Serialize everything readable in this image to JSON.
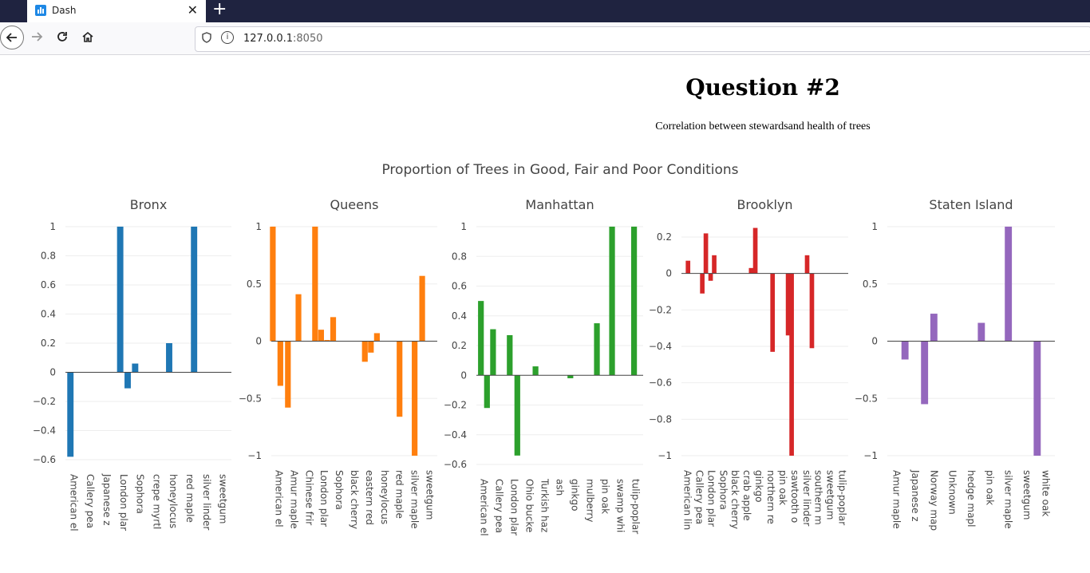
{
  "browser": {
    "tab_title": "Dash",
    "tab_close": "✕",
    "new_tab": "+",
    "url_host": "127.0.0.1",
    "url_port": ":8050"
  },
  "page": {
    "title": "Question #2",
    "subtitle": "Correlation between stewardsand health of trees"
  },
  "chart_data": {
    "type": "bar",
    "title": "Proportion of Trees in Good, Fair and Poor Conditions",
    "grid": true,
    "subplots": [
      {
        "name": "Bronx",
        "color": "#1f77b4",
        "ylim": [
          -0.6,
          1
        ],
        "yticks": [
          1,
          0.8,
          0.6,
          0.4,
          0.2,
          0,
          -0.2,
          -0.4,
          -0.6
        ],
        "ytick_labels": [
          "1",
          "0.8",
          "0.6",
          "0.4",
          "0.2",
          "0",
          "−0.2",
          "−0.4",
          "−0.6"
        ],
        "categories": [
          "American el",
          "Callery pea",
          "Japanese z",
          "London plar",
          "Sophora",
          "crepe myrtl",
          "honeylocus",
          "red maple",
          "silver linder",
          "sweetgum"
        ],
        "x": [
          0.5,
          1.5,
          2.5,
          3.5,
          4.5,
          5.5,
          6.5,
          7.5,
          8.5,
          9.5
        ],
        "bars": [
          {
            "x": 0.3,
            "y": -0.58
          },
          {
            "x": 3.3,
            "y": 1.0
          },
          {
            "x": 3.75,
            "y": -0.11
          },
          {
            "x": 4.2,
            "y": 0.06
          },
          {
            "x": 6.25,
            "y": 0.2
          },
          {
            "x": 7.75,
            "y": 1.0
          }
        ]
      },
      {
        "name": "Queens",
        "color": "#ff7f0e",
        "ylim": [
          -1,
          1
        ],
        "yticks": [
          1,
          0.5,
          0,
          -0.5,
          -1
        ],
        "ytick_labels": [
          "1",
          "0.5",
          "0",
          "−0.5",
          "−1"
        ],
        "categories": [
          "American el",
          "Amur maple",
          "Chinese frir",
          "London plar",
          "Sophora",
          "black cherry",
          "eastern red",
          "honeylocus",
          "red maple",
          "silver maple",
          "sweetgum"
        ],
        "x": [
          0.5,
          1.5,
          2.5,
          3.5,
          4.5,
          5.5,
          6.5,
          7.5,
          8.5,
          9.5,
          10.5
        ],
        "bars": [
          {
            "x": 0.1,
            "y": 1.0
          },
          {
            "x": 0.6,
            "y": -0.39
          },
          {
            "x": 1.1,
            "y": -0.58
          },
          {
            "x": 1.8,
            "y": 0.41
          },
          {
            "x": 2.9,
            "y": 1.0
          },
          {
            "x": 3.3,
            "y": 0.1
          },
          {
            "x": 3.7,
            "y": 0.01
          },
          {
            "x": 4.1,
            "y": 0.21
          },
          {
            "x": 6.2,
            "y": -0.18
          },
          {
            "x": 6.6,
            "y": -0.1
          },
          {
            "x": 7.0,
            "y": 0.07
          },
          {
            "x": 8.5,
            "y": -0.66
          },
          {
            "x": 9.5,
            "y": -1.0
          },
          {
            "x": 10.0,
            "y": 0.57
          }
        ]
      },
      {
        "name": "Manhattan",
        "color": "#2ca02c",
        "ylim": [
          -0.6,
          1
        ],
        "yticks": [
          1,
          0.8,
          0.6,
          0.4,
          0.2,
          0,
          -0.2,
          -0.4,
          -0.6
        ],
        "ytick_labels": [
          "1",
          "0.8",
          "0.6",
          "0.4",
          "0.2",
          "0",
          "−0.2",
          "−0.4",
          "−0.6"
        ],
        "categories": [
          "American el",
          "Callery pea",
          "London plar",
          "Ohio bucke",
          "Turkish haz",
          "ash",
          "ginkgo",
          "mulberry",
          "pin oak",
          "swamp whi",
          "tulip-poplar"
        ],
        "x": [
          0.5,
          1.5,
          2.5,
          3.5,
          4.5,
          5.5,
          6.5,
          7.5,
          8.5,
          9.5,
          10.5
        ],
        "bars": [
          {
            "x": 0.3,
            "y": 0.5
          },
          {
            "x": 0.7,
            "y": -0.22
          },
          {
            "x": 1.1,
            "y": 0.31
          },
          {
            "x": 2.2,
            "y": 0.27
          },
          {
            "x": 2.7,
            "y": -0.54
          },
          {
            "x": 3.9,
            "y": 0.06
          },
          {
            "x": 6.2,
            "y": -0.02
          },
          {
            "x": 7.95,
            "y": 0.35
          },
          {
            "x": 8.95,
            "y": 1.0
          },
          {
            "x": 10.4,
            "y": 1.0
          }
        ]
      },
      {
        "name": "Brooklyn",
        "color": "#d62728",
        "ylim": [
          -1.02,
          0.28
        ],
        "yticks": [
          0.2,
          0,
          -0.2,
          -0.4,
          -0.6,
          -0.8,
          -1
        ],
        "ytick_labels": [
          "0.2",
          "0",
          "−0.2",
          "−0.4",
          "−0.6",
          "−0.8",
          "−1"
        ],
        "categories": [
          "American lin",
          "Callery pea",
          "London plar",
          "Sophora",
          "black cherry",
          "crab apple",
          "ginkgo",
          "northern re",
          "pin oak",
          "sawtooth o",
          "silver linder",
          "southern m",
          "sweetgum",
          "tulip-poplar"
        ],
        "x": [
          0.5,
          1.5,
          2.5,
          3.5,
          4.5,
          5.5,
          6.5,
          7.5,
          8.5,
          9.5,
          10.5,
          11.5,
          12.5,
          13.5
        ],
        "bars": [
          {
            "x": 0.55,
            "y": 0.07
          },
          {
            "x": 1.75,
            "y": -0.11
          },
          {
            "x": 2.05,
            "y": 0.22
          },
          {
            "x": 2.45,
            "y": -0.04
          },
          {
            "x": 2.75,
            "y": 0.1
          },
          {
            "x": 5.85,
            "y": 0.03
          },
          {
            "x": 6.2,
            "y": 0.25
          },
          {
            "x": 7.65,
            "y": -0.43
          },
          {
            "x": 8.95,
            "y": -0.34
          },
          {
            "x": 9.25,
            "y": -1.0
          },
          {
            "x": 10.55,
            "y": 0.1
          },
          {
            "x": 10.95,
            "y": -0.41
          }
        ]
      },
      {
        "name": "Staten Island",
        "color": "#9467bd",
        "ylim": [
          -1,
          1
        ],
        "yticks": [
          1,
          0.5,
          0,
          -0.5,
          -1
        ],
        "ytick_labels": [
          "1",
          "0.5",
          "0",
          "−0.5",
          "−1"
        ],
        "categories": [
          "Amur maple",
          "Japanese z",
          "Norway map",
          "Unknown",
          "hedge mapl",
          "pin oak",
          "silver maple",
          "sweetgum",
          "white oak"
        ],
        "x": [
          0.5,
          1.5,
          2.5,
          3.5,
          4.5,
          5.5,
          6.5,
          7.5,
          8.5
        ],
        "bars": [
          {
            "x": 0.95,
            "y": -0.16
          },
          {
            "x": 2.0,
            "y": -0.55
          },
          {
            "x": 2.5,
            "y": 0.24
          },
          {
            "x": 5.05,
            "y": 0.16
          },
          {
            "x": 6.5,
            "y": 1.0
          },
          {
            "x": 8.05,
            "y": -1.0
          }
        ]
      }
    ]
  }
}
